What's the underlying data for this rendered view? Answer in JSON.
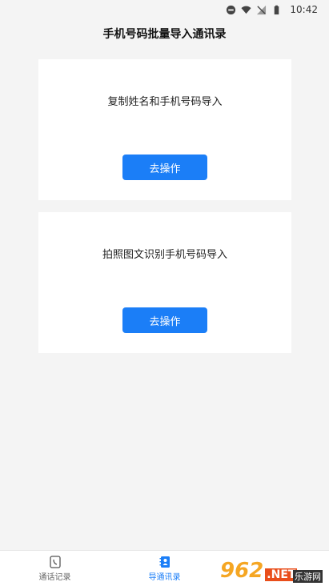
{
  "status_bar": {
    "time": "10:42"
  },
  "header": {
    "title": "手机号码批量导入通讯录"
  },
  "cards": [
    {
      "title": "复制姓名和手机号码导入",
      "button": "去操作"
    },
    {
      "title": "拍照图文识别手机号码导入",
      "button": "去操作"
    }
  ],
  "tabbar": {
    "items": [
      {
        "label": "通话记录",
        "icon": "phone-icon"
      },
      {
        "label": "导通讯录",
        "icon": "contacts-icon"
      }
    ]
  },
  "colors": {
    "accent": "#1b7ef7",
    "background": "#f4f4f4"
  },
  "watermark": {
    "number": "962",
    "suffix": ".NET",
    "sub": "乐游网"
  }
}
